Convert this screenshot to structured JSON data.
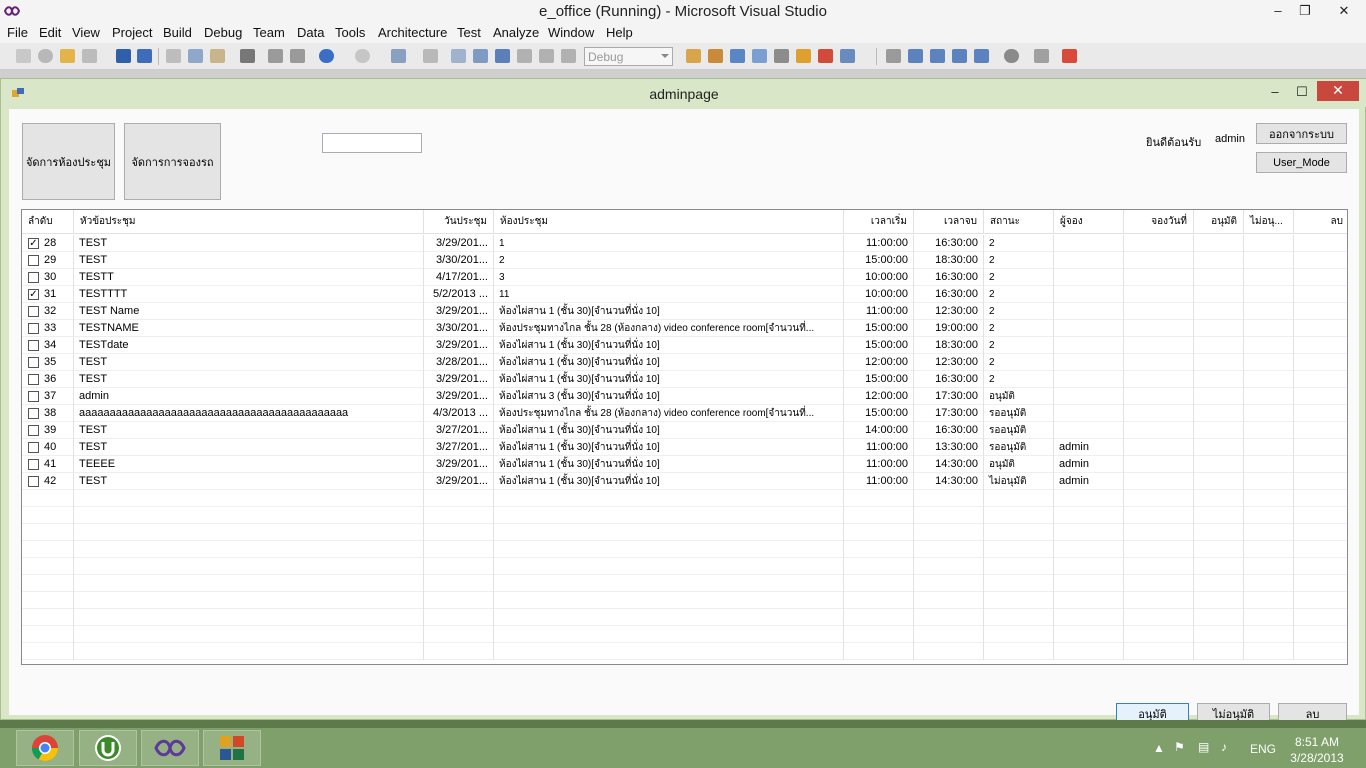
{
  "vs": {
    "title": "e_office (Running) - Microsoft Visual Studio",
    "menu": [
      "File",
      "Edit",
      "View",
      "Project",
      "Build",
      "Debug",
      "Team",
      "Data",
      "Tools",
      "Architecture",
      "Test",
      "Analyze",
      "Window",
      "Help"
    ],
    "config_combo": "Debug",
    "controls": {
      "minimize": "–",
      "restore": "❐",
      "close": "✕"
    }
  },
  "form": {
    "title": "adminpage",
    "controls": {
      "minimize": "–",
      "maximize": "☐",
      "close": "✕"
    },
    "btn_rooms": "จัดการห้องประชุม",
    "btn_cars": "จัดการการจองรถ",
    "search_value": "",
    "welcome_label": "ยินดีต้อนรับ",
    "username": "admin",
    "btn_logout": "ออกจากระบบ",
    "btn_user_mode": "User_Mode",
    "btn_approve": "อนุมัติ",
    "btn_reject": "ไม่อนุมัติ",
    "btn_delete": "ลบ"
  },
  "grid": {
    "columns": [
      "ลำดับ",
      "หัวข้อประชุม",
      "วันประชุม",
      "ห้องประชุม",
      "เวลาเริ่ม",
      "เวลาจบ",
      "สถานะ",
      "ผู้จอง",
      "จองวันที่",
      "อนุมัติ",
      "ไม่อนุ...",
      "ลบ"
    ],
    "rows": [
      {
        "checked": true,
        "id": "28",
        "topic": "TEST",
        "date": "3/29/201...",
        "room": "1",
        "start": "11:00:00",
        "end": "16:30:00",
        "status": "2",
        "booker": ""
      },
      {
        "checked": false,
        "id": "29",
        "topic": "TEST",
        "date": "3/30/201...",
        "room": "2",
        "start": "15:00:00",
        "end": "18:30:00",
        "status": "2",
        "booker": ""
      },
      {
        "checked": false,
        "id": "30",
        "topic": "TESTT",
        "date": "4/17/201...",
        "room": "3",
        "start": "10:00:00",
        "end": "16:30:00",
        "status": "2",
        "booker": ""
      },
      {
        "checked": true,
        "id": "31",
        "topic": "TESTTTT",
        "date": "5/2/2013 ...",
        "room": "11",
        "start": "10:00:00",
        "end": "16:30:00",
        "status": "2",
        "booker": ""
      },
      {
        "checked": false,
        "id": "32",
        "topic": "TEST Name",
        "date": "3/29/201...",
        "room": "ห้องไผ่สาน 1 (ชั้น 30)[จำนวนที่นั่ง 10]",
        "start": "11:00:00",
        "end": "12:30:00",
        "status": "2",
        "booker": ""
      },
      {
        "checked": false,
        "id": "33",
        "topic": "TESTNAME",
        "date": "3/30/201...",
        "room": "ห้องประชุมทางไกล ชั้น 28 (ห้องกลาง) video conference room[จำนวนที่...",
        "start": "15:00:00",
        "end": "19:00:00",
        "status": "2",
        "booker": ""
      },
      {
        "checked": false,
        "id": "34",
        "topic": "TESTdate",
        "date": "3/29/201...",
        "room": "ห้องไผ่สาน 1 (ชั้น 30)[จำนวนที่นั่ง 10]",
        "start": "15:00:00",
        "end": "18:30:00",
        "status": "2",
        "booker": ""
      },
      {
        "checked": false,
        "id": "35",
        "topic": "TEST",
        "date": "3/28/201...",
        "room": "ห้องไผ่สาน 1 (ชั้น 30)[จำนวนที่นั่ง 10]",
        "start": "12:00:00",
        "end": "12:30:00",
        "status": "2",
        "booker": ""
      },
      {
        "checked": false,
        "id": "36",
        "topic": "TEST",
        "date": "3/29/201...",
        "room": "ห้องไผ่สาน 1 (ชั้น 30)[จำนวนที่นั่ง 10]",
        "start": "15:00:00",
        "end": "16:30:00",
        "status": "2",
        "booker": ""
      },
      {
        "checked": false,
        "id": "37",
        "topic": "admin",
        "date": "3/29/201...",
        "room": "ห้องไผ่สาน 3 (ชั้น 30)[จำนวนที่นั่ง 10]",
        "start": "12:00:00",
        "end": "17:30:00",
        "status": "อนุมัติ",
        "booker": ""
      },
      {
        "checked": false,
        "id": "38",
        "topic": "aaaaaaaaaaaaaaaaaaaaaaaaaaaaaaaaaaaaaaaaaaaa",
        "date": "4/3/2013 ...",
        "room": "ห้องประชุมทางไกล ชั้น 28 (ห้องกลาง) video conference room[จำนวนที่...",
        "start": "15:00:00",
        "end": "17:30:00",
        "status": "รออนุมัติ",
        "booker": ""
      },
      {
        "checked": false,
        "id": "39",
        "topic": "TEST",
        "date": "3/27/201...",
        "room": "ห้องไผ่สาน 1 (ชั้น 30)[จำนวนที่นั่ง 10]",
        "start": "14:00:00",
        "end": "16:30:00",
        "status": "รออนุมัติ",
        "booker": ""
      },
      {
        "checked": false,
        "id": "40",
        "topic": "TEST",
        "date": "3/27/201...",
        "room": "ห้องไผ่สาน 1 (ชั้น 30)[จำนวนที่นั่ง 10]",
        "start": "11:00:00",
        "end": "13:30:00",
        "status": "รออนุมัติ",
        "booker": "admin"
      },
      {
        "checked": false,
        "id": "41",
        "topic": "TEEEE",
        "date": "3/29/201...",
        "room": "ห้องไผ่สาน 1 (ชั้น 30)[จำนวนที่นั่ง 10]",
        "start": "11:00:00",
        "end": "14:30:00",
        "status": "อนุมัติ",
        "booker": "admin"
      },
      {
        "checked": false,
        "id": "42",
        "topic": "TEST",
        "date": "3/29/201...",
        "room": "ห้องไผ่สาน 1 (ชั้น 30)[จำนวนที่นั่ง 10]",
        "start": "11:00:00",
        "end": "14:30:00",
        "status": "ไม่อนุมัติ",
        "booker": "admin"
      }
    ]
  },
  "taskbar": {
    "apps": [
      "chrome-icon",
      "utorrent-icon",
      "visual-studio-icon",
      "office-icon"
    ],
    "language": "ENG",
    "time": "8:51 AM",
    "date": "3/28/2013"
  },
  "colors": {
    "form_bg": "#d9e7c8",
    "close_red": "#c9483e",
    "taskbar": "#7fa06a"
  }
}
